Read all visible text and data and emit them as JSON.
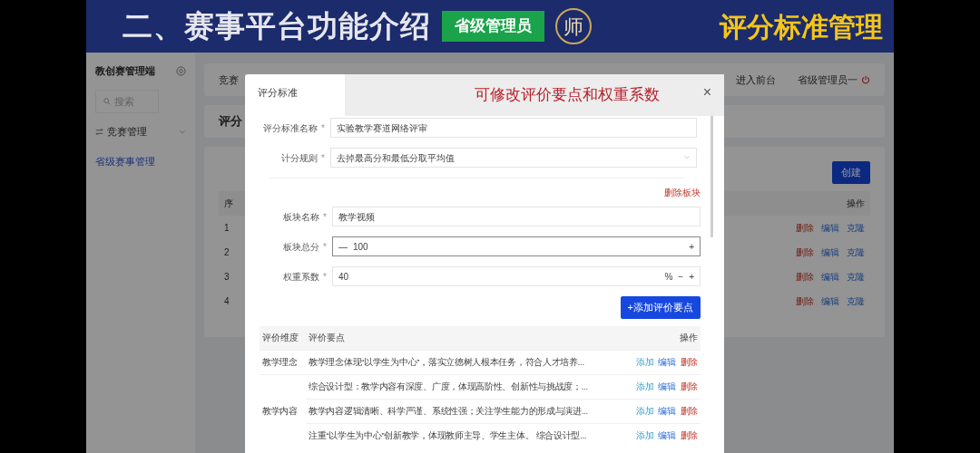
{
  "slide_header": {
    "title": "二、赛事平台功能介绍",
    "role_badge": "省级管理员",
    "logo_text": "师",
    "topic": "评分标准管理"
  },
  "sidebar": {
    "app_name": "教创赛管理端",
    "search_placeholder": "搜索",
    "groups": [
      {
        "label": "竞赛管理",
        "expanded": true,
        "items": [
          {
            "label": "省级赛事管理",
            "selected": true
          }
        ]
      }
    ]
  },
  "top_bar": {
    "breadcrumb": "竞赛",
    "link": "进入前台",
    "user": "省级管理员一"
  },
  "page": {
    "title": "评分",
    "create_button": "创建",
    "columns": [
      "序",
      "操作"
    ],
    "rows": [
      {
        "index": "1",
        "actions": [
          {
            "label": "删除",
            "kind": "danger"
          },
          {
            "label": "编辑",
            "kind": "link"
          },
          {
            "label": "克隆",
            "kind": "link"
          }
        ]
      },
      {
        "index": "2",
        "actions": [
          {
            "label": "删除",
            "kind": "danger"
          },
          {
            "label": "编辑",
            "kind": "link"
          },
          {
            "label": "克隆",
            "kind": "link"
          }
        ]
      },
      {
        "index": "3",
        "actions": [
          {
            "label": "删除",
            "kind": "danger"
          },
          {
            "label": "编辑",
            "kind": "link"
          },
          {
            "label": "克隆",
            "kind": "link"
          }
        ]
      },
      {
        "index": "4",
        "actions": [
          {
            "label": "删除",
            "kind": "danger"
          },
          {
            "label": "编辑",
            "kind": "link"
          },
          {
            "label": "克隆",
            "kind": "link"
          }
        ]
      }
    ]
  },
  "annotation": "可修改评价要点和权重系数",
  "dialog": {
    "title": "评分标准",
    "close": "×",
    "fields": [
      {
        "label": "评分标准名称",
        "required_mark": "*",
        "kind": "text",
        "value": "实验教学赛道网络评审"
      },
      {
        "label": "计分规则",
        "required_mark": "*",
        "kind": "select",
        "value": "去掉最高分和最低分取平均值"
      }
    ],
    "section": {
      "delete_link": "删除板块",
      "fields": [
        {
          "label": "板块名称",
          "required_mark": "*",
          "kind": "text",
          "value": "教学视频"
        },
        {
          "label": "板块总分",
          "required_mark": "*",
          "kind": "stepper",
          "value": "100",
          "decrement": "—",
          "increment": "+",
          "focused": true
        },
        {
          "label": "权重系数",
          "required_mark": "*",
          "kind": "percent",
          "value": "40",
          "unit": "%",
          "decrement": "−",
          "increment": "+"
        }
      ],
      "add_button": "+添加评价要点",
      "columns": [
        "评价维度",
        "评价要点",
        "操作"
      ],
      "groups": [
        {
          "dimension": "教学理念",
          "points": [
            {
              "text": "教学理念体现“以学生为中心”，落实立德树人根本任务，符合人才培养...",
              "actions": [
                {
                  "label": "添加",
                  "kind": "add"
                },
                {
                  "label": "编辑",
                  "kind": "link"
                },
                {
                  "label": "删除",
                  "kind": "danger"
                }
              ]
            }
          ]
        },
        {
          "dimension": "教学内容",
          "points": [
            {
              "text": "综合设计型：教学内容有深度、广度，体现高阶性、创新性与挑战度；...",
              "actions": [
                {
                  "label": "添加",
                  "kind": "add"
                },
                {
                  "label": "编辑",
                  "kind": "link"
                },
                {
                  "label": "删除",
                  "kind": "danger"
                }
              ]
            },
            {
              "text": "教学内容逻辑清晰、科学严谨、系统性强；关注学生能力的形成与演进...",
              "actions": [
                {
                  "label": "添加",
                  "kind": "add"
                },
                {
                  "label": "编辑",
                  "kind": "link"
                },
                {
                  "label": "删除",
                  "kind": "danger"
                }
              ]
            },
            {
              "text": "注重“以学生为中心”创新教学，体现教师主导、学生主体。 综合设计型...",
              "actions": [
                {
                  "label": "添加",
                  "kind": "add"
                },
                {
                  "label": "编辑",
                  "kind": "link"
                },
                {
                  "label": "删除",
                  "kind": "danger"
                }
              ]
            }
          ]
        }
      ]
    }
  }
}
